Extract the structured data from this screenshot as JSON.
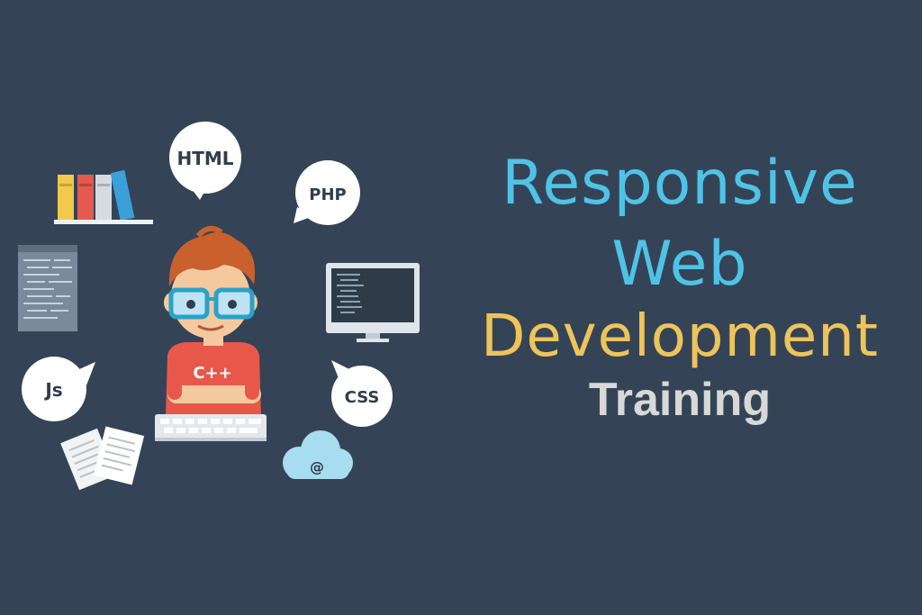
{
  "headline": {
    "line1": "Responsive",
    "line2": "Web",
    "line3": "Development",
    "line4": "Training"
  },
  "bubbles": {
    "html": "HTML",
    "php": "PHP",
    "js": "Js",
    "css": "CSS",
    "cloud": "@"
  },
  "shirt_label": "C++",
  "colors": {
    "background": "#344456",
    "line_blue": "#4fc3e6",
    "line_yellow": "#ecc45a",
    "line_gray": "#d8d8d8"
  }
}
